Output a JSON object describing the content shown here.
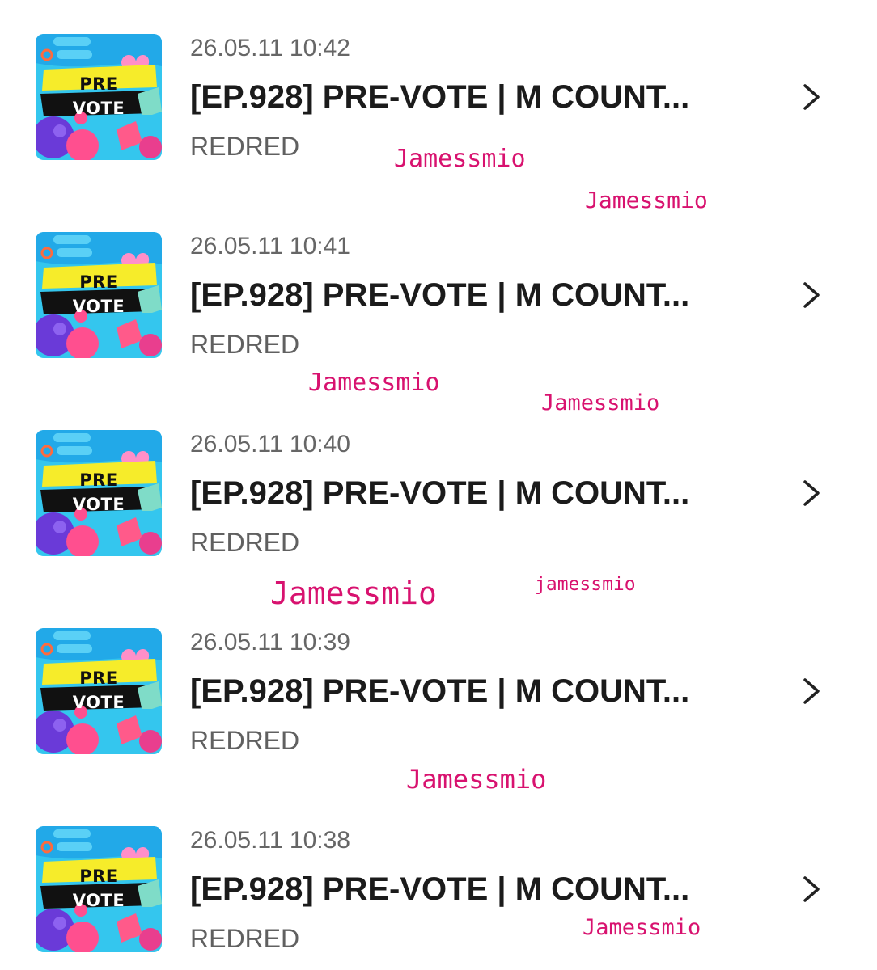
{
  "items": [
    {
      "timestamp": "26.05.11 10:42",
      "title": "[EP.928] PRE-VOTE | M COUNT...",
      "author": "REDRED",
      "thumb_pre": "PRE",
      "thumb_vote": "VOTE"
    },
    {
      "timestamp": "26.05.11 10:41",
      "title": "[EP.928] PRE-VOTE | M COUNT...",
      "author": "REDRED",
      "thumb_pre": "PRE",
      "thumb_vote": "VOTE"
    },
    {
      "timestamp": "26.05.11 10:40",
      "title": "[EP.928] PRE-VOTE | M COUNT...",
      "author": "REDRED",
      "thumb_pre": "PRE",
      "thumb_vote": "VOTE"
    },
    {
      "timestamp": "26.05.11 10:39",
      "title": "[EP.928] PRE-VOTE | M COUNT...",
      "author": "REDRED",
      "thumb_pre": "PRE",
      "thumb_vote": "VOTE"
    },
    {
      "timestamp": "26.05.11 10:38",
      "title": "[EP.928] PRE-VOTE | M COUNT...",
      "author": "REDRED",
      "thumb_pre": "PRE",
      "thumb_vote": "VOTE"
    }
  ],
  "watermarks": [
    "Jamessmio",
    "Jamessmio",
    "Jamessmio",
    "Jamessmio",
    "Jamessmio",
    "jamessmio",
    "Jamessmio",
    "Jamessmio"
  ],
  "icons": {
    "row_arrow": "chevron-right-icon",
    "thumbnail": "pre-vote-thumbnail"
  },
  "colors": {
    "watermark": "#d8126f",
    "title": "#1b1b1b",
    "timestamp": "#666666",
    "author": "#606060",
    "thumb_background": "#34c6ee",
    "thumb_yellow_band": "#f6ec2a",
    "thumb_black_band": "#111111"
  }
}
